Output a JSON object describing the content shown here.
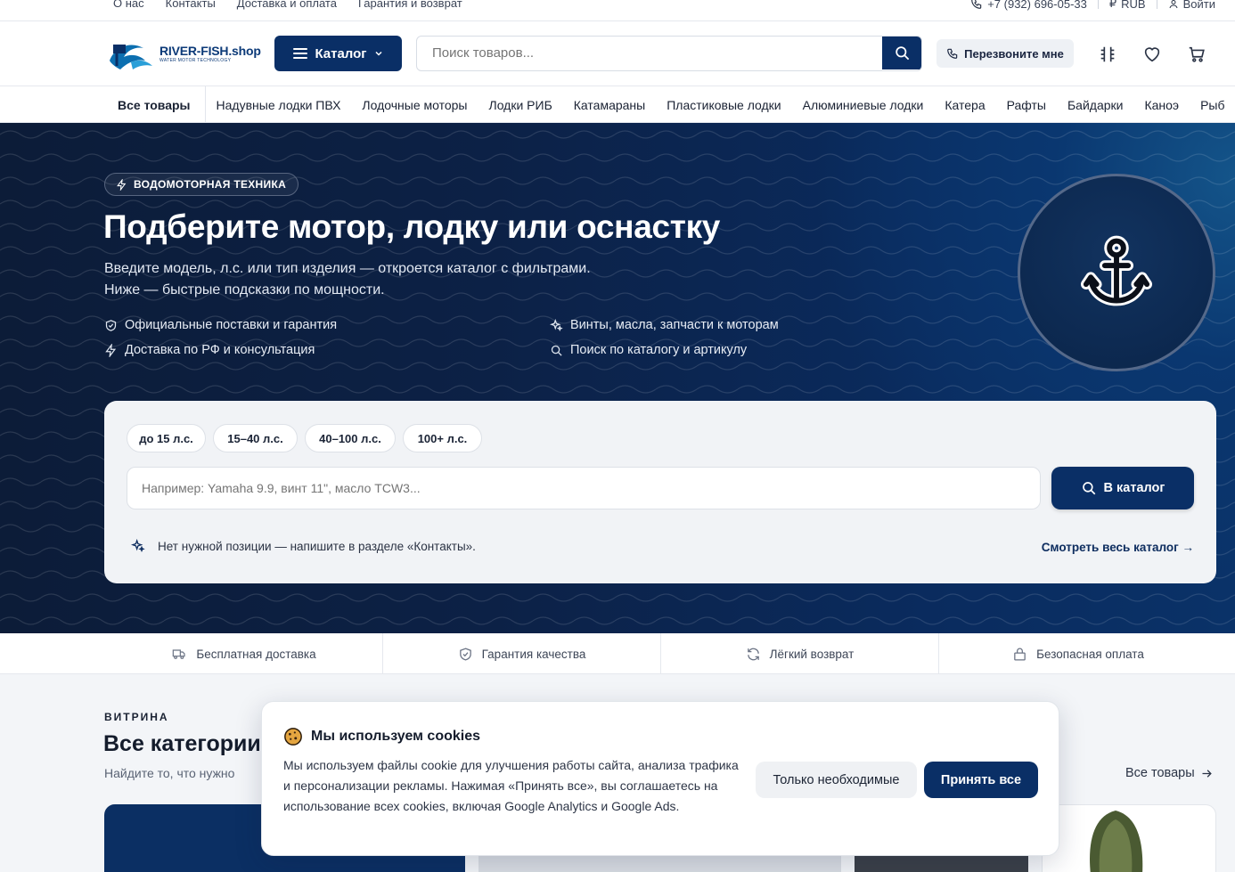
{
  "topbar": {
    "links": [
      "О нас",
      "Контакты",
      "Доставка и оплата",
      "Гарантия и возврат"
    ],
    "phone": "+7 (932) 696-05-33",
    "currency": "RUB",
    "login": "Войти"
  },
  "header": {
    "logo_name": "RIVER-FISH.shop",
    "logo_tagline": "WATER MOTOR TECHNOLOGY",
    "catalog_label": "Каталог",
    "search_placeholder": "Поиск товаров...",
    "callback_label": "Перезвоните мне"
  },
  "nav": {
    "items": [
      "Все товары",
      "Надувные лодки ПВХ",
      "Лодочные моторы",
      "Лодки РИБ",
      "Катамараны",
      "Пластиковые лодки",
      "Алюминиевые лодки",
      "Катера",
      "Рафты",
      "Байдарки",
      "Каноэ",
      "Рыб"
    ]
  },
  "hero": {
    "badge": "ВОДОМОТОРНАЯ ТЕХНИКА",
    "title": "Подберите мотор, лодку или оснастку",
    "subtitle_line1": "Введите модель, л.с. или тип изделия — откроется каталог с фильтрами.",
    "subtitle_line2": "Ниже — быстрые подсказки по мощности.",
    "features": [
      "Официальные поставки и гарантия",
      "Винты, масла, запчасти к моторам",
      "Доставка по РФ и консультация",
      "Поиск по каталогу и артикулу"
    ],
    "search_card": {
      "chips": [
        "до 15 л.с.",
        "15–40 л.с.",
        "40–100 л.с.",
        "100+ л.с."
      ],
      "input_placeholder": "Например: Yamaha 9.9, винт 11\", масло TCW3...",
      "button_label": "В каталог",
      "note": "Нет нужной позиции — напишите в разделе «Контакты».",
      "all_link": "Смотреть весь каталог →"
    }
  },
  "benefits": [
    "Бесплатная доставка",
    "Гарантия качества",
    "Лёгкий возврат",
    "Безопасная оплата"
  ],
  "showcase": {
    "kicker": "ВИТРИНА",
    "title": "Все категории",
    "subtitle": "Найдите то, что нужно",
    "all_link": "Все товары"
  },
  "cookie": {
    "title": "Мы используем cookies",
    "text": "Мы используем файлы cookie для улучшения работы сайта, анализа трафика и персонализации рекламы. Нажимая «Принять все», вы соглашаетесь на использование всех cookies, включая Google Analytics и Google Ads.",
    "btn_necessary": "Только необходимые",
    "btn_accept": "Принять все"
  },
  "colors": {
    "brand": "#0a2f66",
    "hero_bg": "#0c2146"
  }
}
